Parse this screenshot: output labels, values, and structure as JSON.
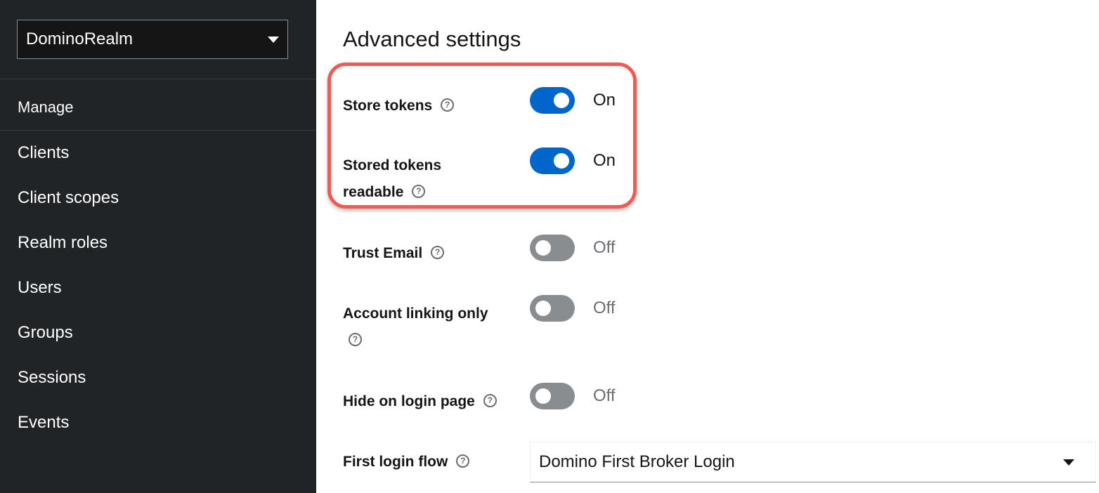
{
  "sidebar": {
    "realm_selector": {
      "value": "DominoRealm",
      "icon": "caret-down-icon"
    },
    "section_title": "Manage",
    "items": [
      {
        "label": "Clients"
      },
      {
        "label": "Client scopes"
      },
      {
        "label": "Realm roles"
      },
      {
        "label": "Users"
      },
      {
        "label": "Groups"
      },
      {
        "label": "Sessions"
      },
      {
        "label": "Events"
      }
    ]
  },
  "main": {
    "title": "Advanced settings",
    "settings": [
      {
        "label": "Store tokens",
        "state": "On",
        "enabled": true
      },
      {
        "label_line1": "Stored tokens",
        "label_line2": "readable",
        "state": "On",
        "enabled": true
      },
      {
        "label": "Trust Email",
        "state": "Off",
        "enabled": false
      },
      {
        "label": "Account linking only",
        "state": "Off",
        "enabled": false
      },
      {
        "label": "Hide on login page",
        "state": "Off",
        "enabled": false
      }
    ],
    "first_login_flow": {
      "label": "First login flow",
      "value": "Domino First Broker Login"
    }
  },
  "colors": {
    "sidebar_bg": "#212427",
    "switch_on": "#0066cc",
    "switch_off": "#8a8d90",
    "highlight_border": "#ef5b50"
  }
}
